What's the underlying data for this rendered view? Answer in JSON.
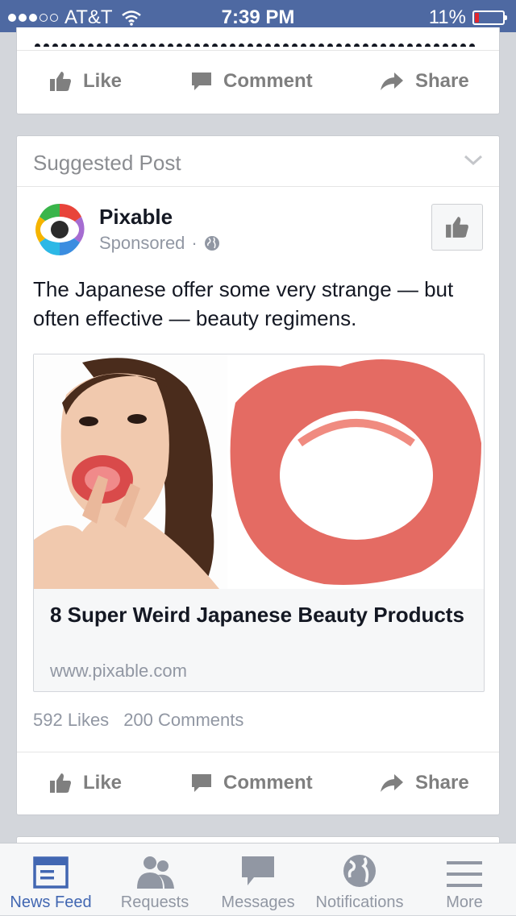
{
  "status_bar": {
    "carrier": "AT&T",
    "time": "7:39 PM",
    "battery": "11%",
    "signal_bars_full": 3,
    "signal_bars_total": 5
  },
  "previous_post": {
    "actions": {
      "like": "Like",
      "comment": "Comment",
      "share": "Share"
    }
  },
  "suggested_post": {
    "header": "Suggested Post",
    "page_name": "Pixable",
    "sponsored": "Sponsored",
    "separator": "·",
    "text": "The Japanese offer some very strange — but often effective — beauty regimens.",
    "link": {
      "title": "8 Super Weird Japanese Beauty Products",
      "domain": "www.pixable.com"
    },
    "likes": "592 Likes",
    "comments": "200 Comments",
    "actions": {
      "like": "Like",
      "comment": "Comment",
      "share": "Share"
    }
  },
  "tab_bar": {
    "tabs": [
      {
        "label": "News Feed",
        "icon": "news-feed-icon",
        "active": true
      },
      {
        "label": "Requests",
        "icon": "friend-requests-icon",
        "active": false
      },
      {
        "label": "Messages",
        "icon": "messages-icon",
        "active": false
      },
      {
        "label": "Notifications",
        "icon": "globe-icon",
        "active": false
      },
      {
        "label": "More",
        "icon": "hamburger-menu-icon",
        "active": false
      }
    ]
  },
  "colors": {
    "header_blue": "#4e69a2",
    "active_tab": "#4267b2",
    "inactive": "#9197a3",
    "battery_low": "#e0262e"
  }
}
